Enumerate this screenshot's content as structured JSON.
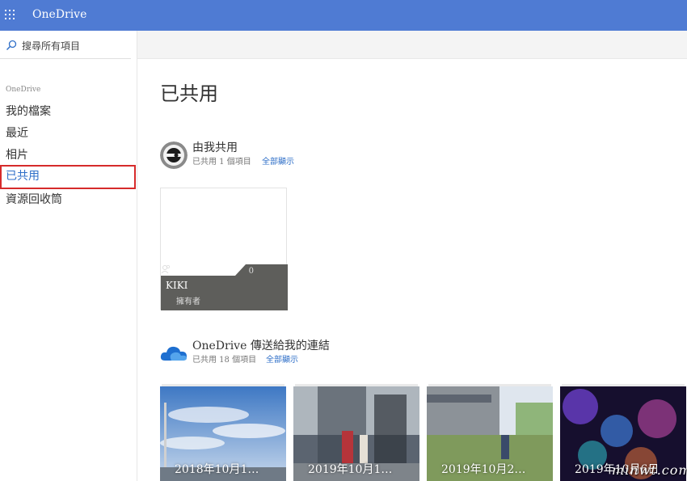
{
  "app": {
    "title": "OneDrive"
  },
  "sidebar": {
    "search_placeholder": "搜尋所有項目",
    "heading": "OneDrive",
    "items": [
      {
        "label": "我的檔案"
      },
      {
        "label": "最近"
      },
      {
        "label": "相片"
      },
      {
        "label": "已共用"
      },
      {
        "label": "資源回收筒"
      }
    ]
  },
  "main": {
    "page_title": "已共用",
    "shared_by_me": {
      "title": "由我共用",
      "subtitle": "已共用 1 個項目",
      "show_all": "全部顯示"
    },
    "folder": {
      "count": "0",
      "name": "KIKI",
      "owner": "擁有者"
    },
    "links_to_me": {
      "title": "OneDrive 傳送給我的連結",
      "subtitle": "已共用 18 個項目",
      "show_all": "全部顯示"
    },
    "photos": [
      {
        "caption": "2018年10月1…"
      },
      {
        "caption": "2019年10月1…"
      },
      {
        "caption": "2019年10月2…"
      },
      {
        "caption": "2019年10月6日"
      }
    ]
  },
  "watermark": "minwt.com",
  "colors": {
    "topbar": "#4f7bd3",
    "accent": "#2f6fc8",
    "highlight_border": "#d62b2b",
    "folder_tab": "#5e5e5b"
  }
}
